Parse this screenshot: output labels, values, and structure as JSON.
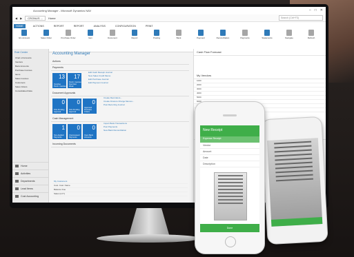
{
  "window": {
    "title": "Accounting Manager - Microsoft Dynamics NAV",
    "controls": [
      "–",
      "□",
      "✕"
    ]
  },
  "address": {
    "company": "CRONUS ...",
    "home": "Home",
    "search_placeholder": "Search (Ctrl+F3)"
  },
  "tabs": [
    "HOME",
    "ACTIONS",
    "REPORT",
    "REPORT",
    "ANALYSIS",
    "CONFIGURATION",
    "PRINT"
  ],
  "ribbon": {
    "buttons": [
      "G/L Account",
      "Sales Order",
      "Purchase Order",
      "Item",
      "Document",
      "Report",
      "Posting",
      "Bank",
      "Payment",
      "Reconciliation",
      "Payments",
      "Statements",
      "Navigate",
      "Refresh"
    ]
  },
  "sidebar": {
    "header": "Role Center",
    "items": [
      "Chart of Accounts",
      "Vendors",
      "Bank Accounts",
      "Purchase Invoices",
      "Items",
      "Sales Invoices",
      "Customers",
      "Sales Orders",
      "Consolidated Data"
    ],
    "nav": [
      "Home",
      "Activities",
      "Departments",
      "Lead Items",
      "Cost Accounting"
    ]
  },
  "main": {
    "page_title": "Accounting Manager",
    "section_actions": "Actions",
    "section_payments": "Payments",
    "section_approvals": "Document Approvals",
    "section_cash": "Cash Management",
    "section_incoming": "Incoming Documents",
    "section_customers": "My Customers",
    "tiles_payments": [
      {
        "value": "13",
        "label": "Overdue Purch. Invoices"
      },
      {
        "value": "17",
        "label": "Purch. Invoices Due Next Week"
      }
    ],
    "tiles_approvals": [
      {
        "value": "0",
        "label": "POs Pending Approval"
      },
      {
        "value": "0",
        "label": "SOs Pending Approval"
      },
      {
        "value": "0",
        "label": "Approved Purchase Orders"
      }
    ],
    "tiles_cash": [
      {
        "value": "1",
        "label": "Non-Applied Payments"
      },
      {
        "value": "0",
        "label": "Unprocessed Payments"
      },
      {
        "value": "0",
        "label": "Open Bank Accounts"
      }
    ],
    "links_a": [
      "Edit Cash Receipt Journal",
      "New Sales Credit Memo",
      "Edit Purchase Journal",
      "Edit Payment Journal"
    ],
    "links_b": [
      "Create Reminders...",
      "Create Finance Charge Memos...",
      "Post Recurring Journal"
    ],
    "links_c": [
      "Import Bank Transactions",
      "Post Payments",
      "New Bank Reconciliation"
    ],
    "bottom_rows": [
      "Cust. Cust. Name",
      "Balance Due",
      "Sales (LCY)"
    ]
  },
  "right": {
    "title_1": "Cash Flow Forecast",
    "title_2": "My Vendors",
    "title_3": "Report Inbox",
    "rows": [
      "1000",
      "2000",
      "3000",
      "4000",
      "5000",
      "6000",
      "7000",
      "8000"
    ]
  },
  "phone": {
    "header": "New Receipt",
    "subheader": "Expense Receipt",
    "fields": [
      "Vendor",
      "Amount",
      "Date",
      "Description"
    ],
    "footer": "Done"
  },
  "colors": {
    "accent": "#2f7ab8",
    "tile": "#1f74c4",
    "phone_green": "#3fae49"
  }
}
